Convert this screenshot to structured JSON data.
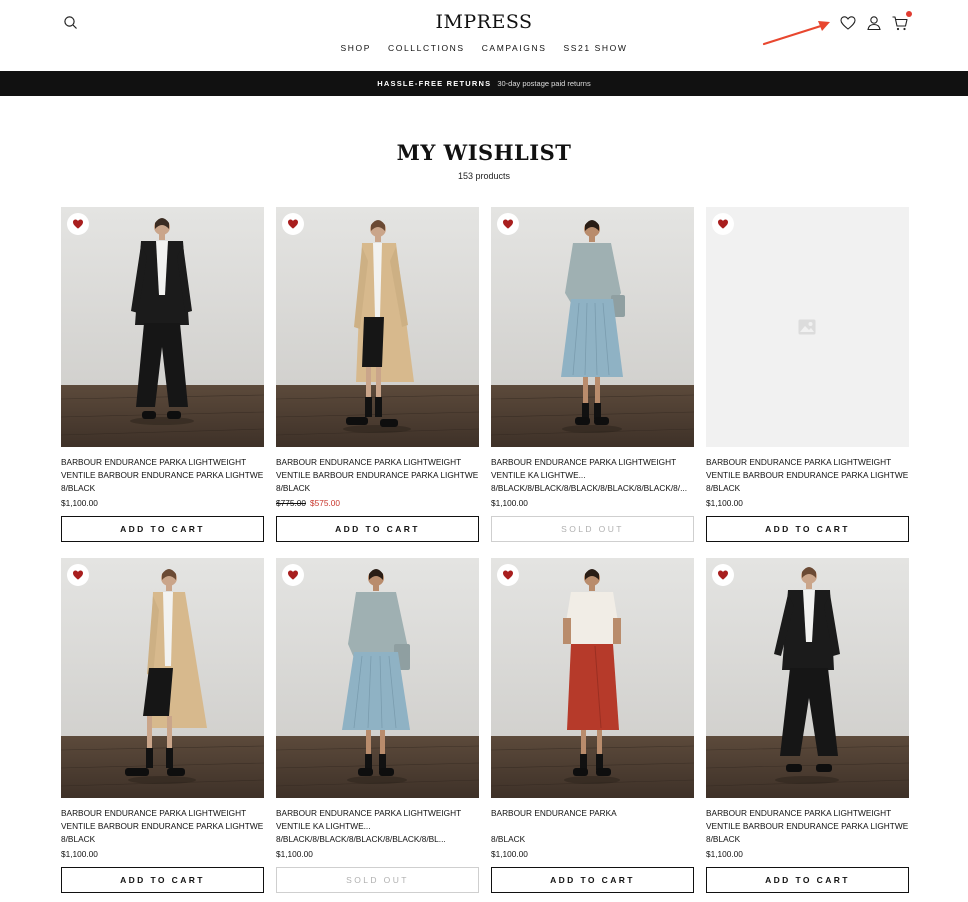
{
  "header": {
    "logo": "IMPRESS",
    "nav": [
      "SHOP",
      "COLLLCTIONS",
      "CAMPAIGNS",
      "SS21 SHOW"
    ]
  },
  "announcement": {
    "strong": "HASSLE-FREE RETURNS",
    "text": "30-day postage paid returns"
  },
  "page": {
    "title": "MY WISHLIST",
    "count": "153 products"
  },
  "colors": {
    "accent_red": "#e03c31",
    "wishlist_heart": "#a81e1e",
    "sale": "#c8372d"
  },
  "products": [
    {
      "name1": "BARBOUR ENDURANCE PARKA LIGHTWEIGHT",
      "name2": "VENTILE BARBOUR ENDURANCE PARKA LIGHTWEIG...",
      "variant": "8/BLACK",
      "price": "$1,100.00",
      "button": "ADD TO CART",
      "button_state": "enabled",
      "image": "black-suit-model"
    },
    {
      "name1": "BARBOUR ENDURANCE PARKA LIGHTWEIGHT",
      "name2": "VENTILE BARBOUR ENDURANCE PARKA LIGHTWEIG...",
      "variant": "8/BLACK",
      "old_price": "$775.00",
      "sale_price": "$575.00",
      "button": "ADD TO CART",
      "button_state": "enabled",
      "image": "beige-trench-model"
    },
    {
      "name1": "BARBOUR ENDURANCE PARKA LIGHTWEIGHT",
      "name2": "VENTILE KA LIGHTWE...",
      "variant": "8/BLACK/8/BLACK/8/BLACK/8/BLACK/8/BLACK/8/...",
      "price": "$1,100.00",
      "button": "SOLD OUT",
      "button_state": "disabled",
      "image": "blue-skirt-model"
    },
    {
      "name1": "BARBOUR ENDURANCE PARKA LIGHTWEIGHT",
      "name2": "VENTILE BARBOUR ENDURANCE PARKA LIGHTWEIG...",
      "variant": "8/BLACK",
      "price": "$1,100.00",
      "button": "ADD TO CART",
      "button_state": "enabled",
      "image": "placeholder"
    },
    {
      "name1": "BARBOUR ENDURANCE PARKA LIGHTWEIGHT",
      "name2": "VENTILE BARBOUR ENDURANCE PARKA LIGHTWEIG...",
      "variant": "8/BLACK",
      "price": "$1,100.00",
      "button": "ADD TO CART",
      "button_state": "enabled",
      "image": "beige-trench-model"
    },
    {
      "name1": "BARBOUR ENDURANCE PARKA LIGHTWEIGHT",
      "name2": "VENTILE KA LIGHTWE...",
      "variant": "8/BLACK/8/BLACK/8/BLACK/8/BLACK/8/BL...",
      "price": "$1,100.00",
      "button": "SOLD OUT",
      "button_state": "disabled",
      "image": "blue-skirt-model"
    },
    {
      "name1": "BARBOUR ENDURANCE PARKA",
      "name2": "",
      "variant": "8/BLACK",
      "price": "$1,100.00",
      "button": "ADD TO CART",
      "button_state": "enabled",
      "image": "red-skirt-model"
    },
    {
      "name1": "BARBOUR ENDURANCE PARKA LIGHTWEIGHT",
      "name2": "VENTILE BARBOUR ENDURANCE PARKA LIGHTWEIG...",
      "variant": "8/BLACK",
      "price": "$1,100.00",
      "button": "ADD TO CART",
      "button_state": "enabled",
      "image": "black-suit-model"
    }
  ]
}
